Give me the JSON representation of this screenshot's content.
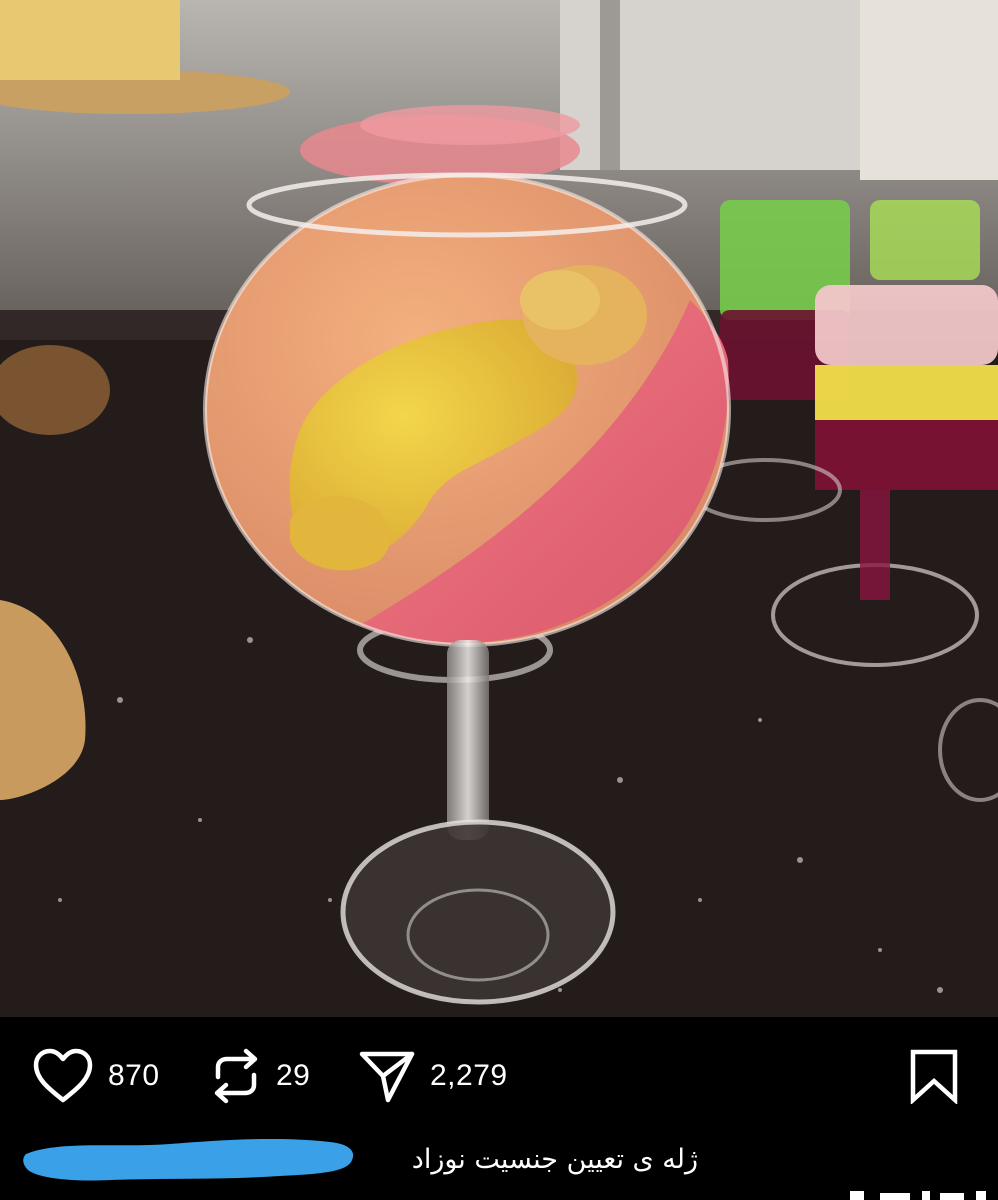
{
  "post": {
    "image_description_icon": "photo-jelly-dessert"
  },
  "actions": {
    "like": {
      "icon": "heart-icon",
      "count": "870"
    },
    "repost": {
      "icon": "repost-icon",
      "count": "29"
    },
    "share": {
      "icon": "send-icon",
      "count": "2,279"
    },
    "save": {
      "icon": "bookmark-icon"
    }
  },
  "caption": {
    "text": "ژله ی تعیین جنسیت نوزاد"
  },
  "colors": {
    "background": "#000000",
    "text": "#ffffff",
    "redaction": "#3aa0e8"
  }
}
